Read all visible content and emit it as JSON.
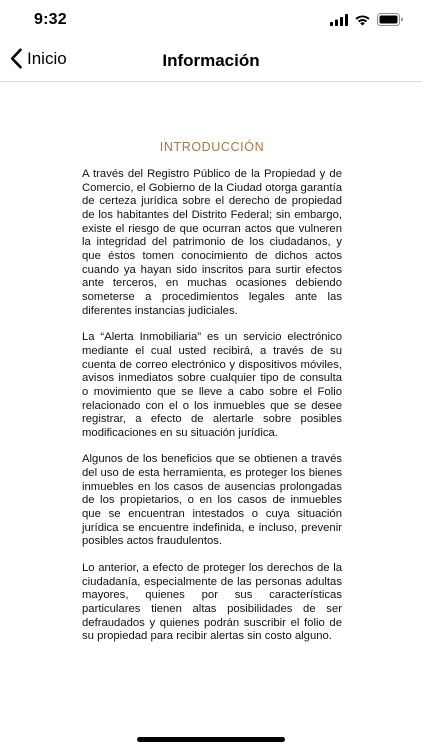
{
  "status_bar": {
    "time": "9:32",
    "icons": [
      "signal-icon",
      "wifi-icon",
      "battery-icon"
    ]
  },
  "nav": {
    "back_label": "Inicio",
    "title": "Información"
  },
  "article": {
    "heading": "INTRODUCCIÓN",
    "paragraphs": [
      "A través del Registro Público de la Propiedad y de Comercio, el Gobierno de la Ciudad otorga garantía de certeza jurídica sobre el derecho de propiedad de los habitantes del Distrito Federal; sin embargo, existe el riesgo de que ocurran actos que vulneren la integridad del patrimonio de los ciudadanos, y que éstos tomen conocimiento de dichos actos cuando ya hayan sido inscritos para surtir efectos ante terceros, en muchas ocasiones debiendo someterse a procedimientos legales ante las diferentes instancias judiciales.",
      "La “Alerta Inmobiliaria” es un servicio electrónico mediante el cual usted recibirá, a través de su cuenta de correo electrónico y dispositivos móviles, avisos inmediatos sobre cualquier tipo de consulta o movimiento que se lleve a cabo sobre el Folio relacionado con el o los inmuebles que se desee registrar, a efecto de alertarle sobre posibles modificaciones en su situación jurídica.",
      "Algunos de los beneficios que se obtienen a través del uso de esta herramienta, es proteger los bienes inmuebles en los casos de ausencias prolongadas de los propietarios, o en los casos de inmuebles que se encuentran intestados o cuya situación jurídica se encuentre indefinida, e incluso, prevenir posibles actos fraudulentos.",
      "Lo anterior, a efecto de proteger los derechos de la ciudadanía, especialmente de las personas adultas mayores, quienes por sus características particulares tienen altas posibilidades de ser defraudados y quienes podrán suscribir el folio de su propiedad para recibir alertas sin costo alguno."
    ]
  },
  "colors": {
    "heading": "#a47b3f",
    "text": "#111111",
    "divider": "#d6d6d6"
  }
}
